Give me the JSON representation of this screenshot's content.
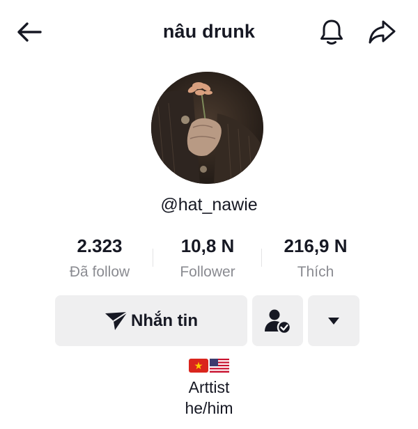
{
  "header": {
    "title": "nâu drunk",
    "back_icon": "arrow-left-icon",
    "notify_icon": "bell-icon",
    "share_icon": "share-arrow-icon"
  },
  "profile": {
    "avatar": "avatar-photo",
    "handle": "@hat_nawie"
  },
  "stats": [
    {
      "value": "2.323",
      "label": "Đã follow"
    },
    {
      "value": "10,8 N",
      "label": "Follower"
    },
    {
      "value": "216,9 N",
      "label": "Thích"
    }
  ],
  "actions": {
    "message_label": "Nhắn tin",
    "message_icon": "send-icon",
    "friend_icon": "user-check-icon",
    "more_icon": "caret-down-icon"
  },
  "bio": {
    "flags": [
      "vietnam-flag",
      "us-flag"
    ],
    "lines": [
      "Arttist",
      "he/him"
    ]
  },
  "colors": {
    "text": "#161823",
    "muted": "#8a8b91",
    "button_bg": "#efeff0"
  }
}
